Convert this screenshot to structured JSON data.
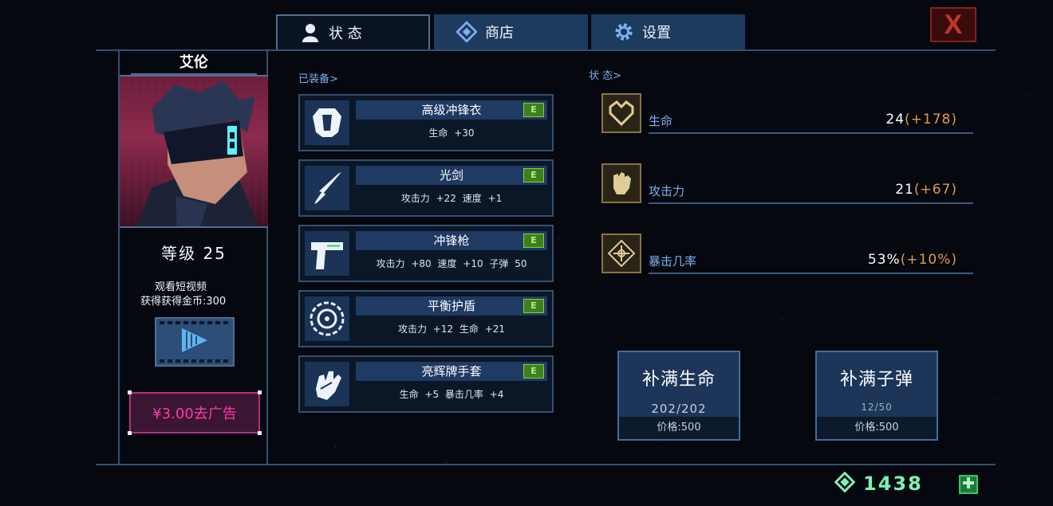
{
  "tabs": [
    {
      "label": "状 态",
      "icon": "person-icon",
      "active": true
    },
    {
      "label": "商店",
      "icon": "diamond-icon",
      "active": false
    },
    {
      "label": "设置",
      "icon": "gear-icon",
      "active": false
    }
  ],
  "close_label": "X",
  "character": {
    "name": "艾伦",
    "level": "等级 25",
    "ad_line1": "观看短视频",
    "ad_line2": "获得获得金币:300",
    "remove_ads": "¥3.00去广告"
  },
  "equipped": {
    "label": "已装备>",
    "items": [
      {
        "name": "高级冲锋衣",
        "stats": "生命 +30",
        "badge": "E",
        "icon": "armor-icon"
      },
      {
        "name": "光剑",
        "stats": "攻击力 +22   速度 +1",
        "badge": "E",
        "icon": "sword-icon"
      },
      {
        "name": "冲锋枪",
        "stats": "攻击力 +80   速度 +10   子弹 50",
        "badge": "E",
        "icon": "gun-icon"
      },
      {
        "name": "平衡护盾",
        "stats": "攻击力 +12   生命 +21",
        "badge": "E",
        "icon": "shield-icon"
      },
      {
        "name": "亮辉牌手套",
        "stats": "生命 +5   暴击几率 +4",
        "badge": "E",
        "icon": "glove-icon"
      }
    ]
  },
  "status": {
    "label": "状 态>",
    "rows": [
      {
        "label": "生命",
        "value": "24",
        "bonus": "(+178)",
        "icon": "heart-icon"
      },
      {
        "label": "攻击力",
        "value": "21",
        "bonus": "(+67)",
        "icon": "fist-icon"
      },
      {
        "label": "暴击几率",
        "value": "53%",
        "bonus": "(+10%)",
        "icon": "crosshair-icon"
      }
    ]
  },
  "refill_hp": {
    "title": "补满生命",
    "amount": "202/202",
    "price": "价格:500"
  },
  "refill_ammo": {
    "title": "补满子弹",
    "amount": "12/50",
    "price": "价格:500"
  },
  "currency": {
    "amount": "1438",
    "icon": "gem-icon"
  },
  "colors": {
    "accent": "#7eaef0",
    "bonus": "#e39a4a",
    "badge": "#3f7f1e",
    "currency": "#7ff0b5",
    "ad": "#ff3aa6"
  }
}
